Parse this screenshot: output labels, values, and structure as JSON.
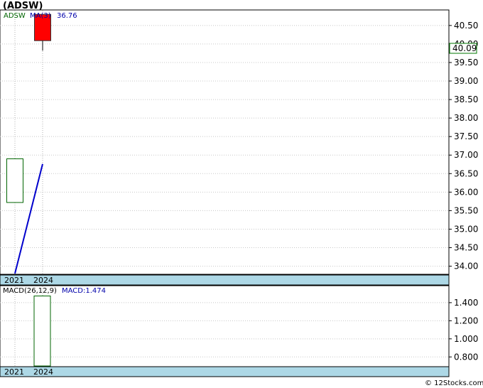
{
  "chart_data": [
    {
      "type": "candlestick",
      "title": "(ADSW)",
      "legend": {
        "symbol": "ADSW",
        "ma_label": "MA(3)",
        "ma_value": "36.76"
      },
      "colors": {
        "up": "#006400",
        "down": "#ff0000",
        "ma": "#0000cc",
        "last_box": "#007700",
        "band": "#add8e6"
      },
      "x_labels": [
        "2021",
        "2024"
      ],
      "ylim": [
        33.8,
        40.9
      ],
      "y_ticks": [
        34.0,
        34.5,
        35.0,
        35.5,
        36.0,
        36.5,
        37.0,
        37.5,
        38.0,
        38.5,
        39.0,
        39.5,
        40.0,
        40.5
      ],
      "y_tick_labels": [
        "34.00",
        "34.50",
        "35.00",
        "35.50",
        "36.00",
        "36.50",
        "37.00",
        "37.50",
        "38.00",
        "38.50",
        "39.00",
        "39.50",
        "40.00",
        "40.50"
      ],
      "candles": [
        {
          "label": "2021",
          "open": 35.72,
          "close": 36.9,
          "high": 36.9,
          "low": 35.72,
          "direction": "up"
        },
        {
          "label": "2024",
          "open": 40.8,
          "close": 40.09,
          "high": 40.8,
          "low": 39.82,
          "direction": "down"
        }
      ],
      "ma_line": [
        {
          "x": "2021",
          "y": 33.8
        },
        {
          "x": "2024",
          "y": 36.76
        }
      ],
      "last_price": "40.09",
      "grid": true
    },
    {
      "type": "bar",
      "title": "MACD(26,12,9)",
      "legend": {
        "label": "MACD(26,12,9)",
        "value_label": "MACD:1.474"
      },
      "x_labels": [
        "2021",
        "2024"
      ],
      "ylim": [
        0.7,
        1.58
      ],
      "y_ticks": [
        0.8,
        1.0,
        1.2,
        1.4
      ],
      "y_tick_labels": [
        "0.800",
        "1.000",
        "1.200",
        "1.400"
      ],
      "bars": [
        {
          "label": "2024",
          "value": 1.474
        }
      ],
      "grid": true
    }
  ],
  "credit": "© 12Stocks.com"
}
